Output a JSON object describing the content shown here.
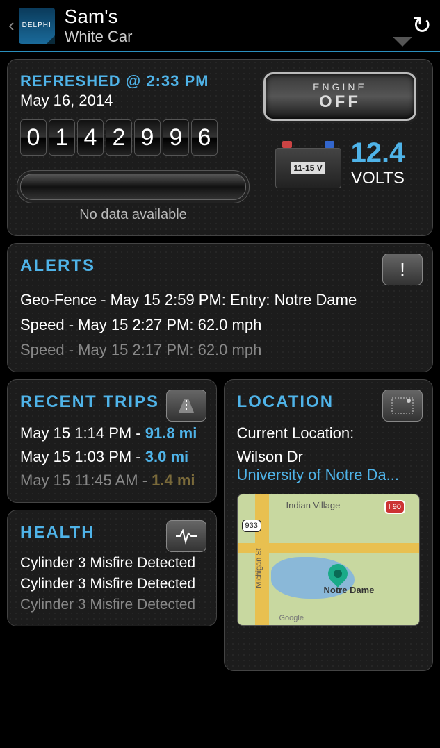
{
  "header": {
    "logo_text": "DELPHI",
    "owner": "Sam's",
    "car": "White Car"
  },
  "status": {
    "refreshed_label": "REFRESHED @ 2:33 PM",
    "date": "May 16, 2014",
    "odometer": [
      "0",
      "1",
      "4",
      "2",
      "9",
      "9",
      "6"
    ],
    "fuel_label": "No data available",
    "engine_label1": "ENGINE",
    "engine_label2": "OFF",
    "battery_label": "11-15 V",
    "volts_value": "12.4",
    "volts_unit": "VOLTS"
  },
  "alerts": {
    "title": "ALERTS",
    "items": [
      "Geo-Fence - May 15 2:59 PM: Entry: Notre Dame",
      "Speed - May 15 2:27 PM: 62.0 mph",
      "Speed - May 15 2:17 PM: 62.0 mph"
    ]
  },
  "trips": {
    "title": "RECENT TRIPS",
    "items": [
      {
        "time": "May 15 1:14 PM - ",
        "dist": "91.8 mi"
      },
      {
        "time": "May 15 1:03 PM - ",
        "dist": "3.0 mi"
      },
      {
        "time": "May 15 11:45 AM - ",
        "dist": "1.4 mi"
      }
    ]
  },
  "health": {
    "title": "HEALTH",
    "items": [
      "Cylinder 3 Misfire Detected",
      "Cylinder 3 Misfire Detected",
      "Cylinder 3 Misfire Detected"
    ]
  },
  "location": {
    "title": "LOCATION",
    "label": "Current Location:",
    "line1": "Wilson Dr",
    "line2": "University of Notre Da...",
    "map": {
      "place1": "Indian Village",
      "place2": "Notre Dame",
      "shield1": "I 90",
      "shield2": "933",
      "attrib": "Google",
      "street": "Michigan St"
    }
  }
}
